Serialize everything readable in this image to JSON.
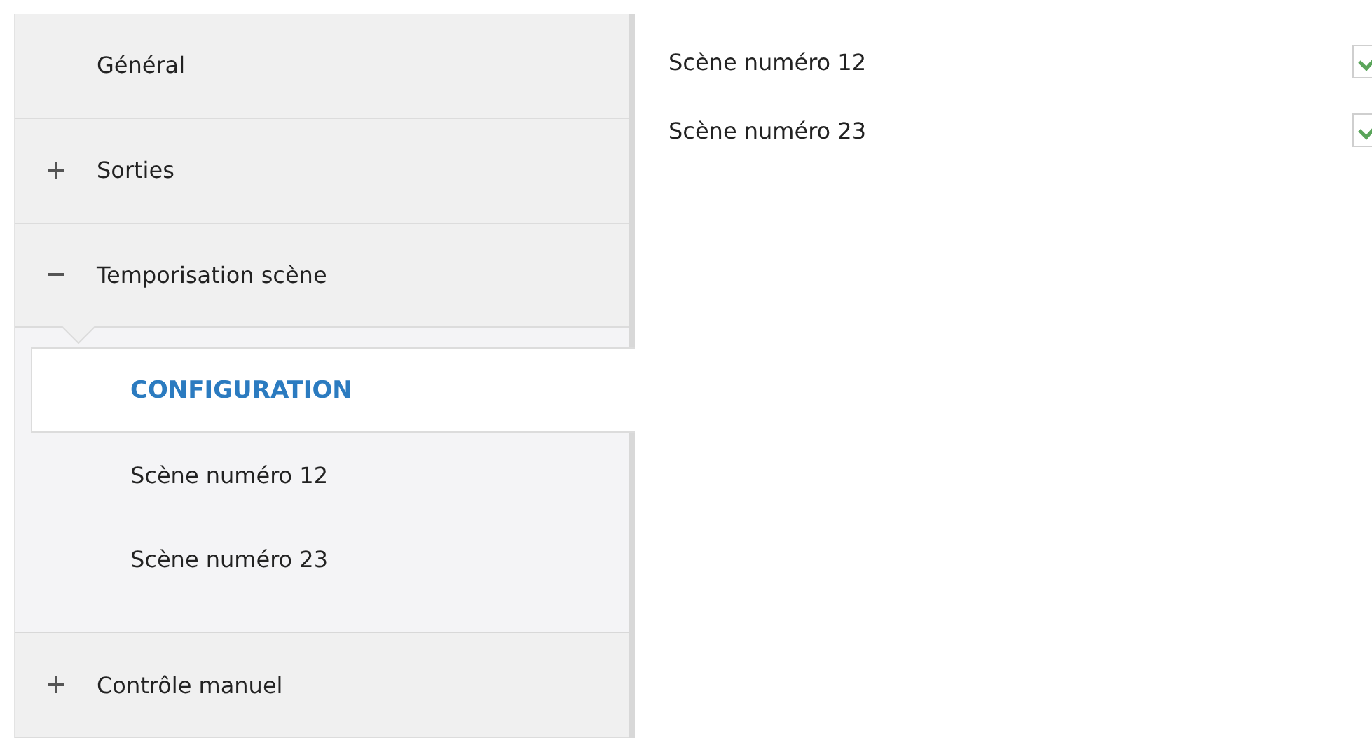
{
  "sidebar": {
    "items": [
      {
        "label": "Général"
      },
      {
        "label": "Sorties",
        "expanded": false
      },
      {
        "label": "Temporisation scène",
        "expanded": true,
        "children": [
          {
            "label": "CONFIGURATION",
            "selected": true
          },
          {
            "label": "Scène numéro 12",
            "selected": false
          },
          {
            "label": "Scène numéro 23",
            "selected": false
          }
        ]
      },
      {
        "label": "Contrôle manuel",
        "expanded": false
      }
    ]
  },
  "settings": [
    {
      "label": "Scène numéro 12",
      "checked": true
    },
    {
      "label": "Scène numéro 23",
      "checked": true
    }
  ]
}
